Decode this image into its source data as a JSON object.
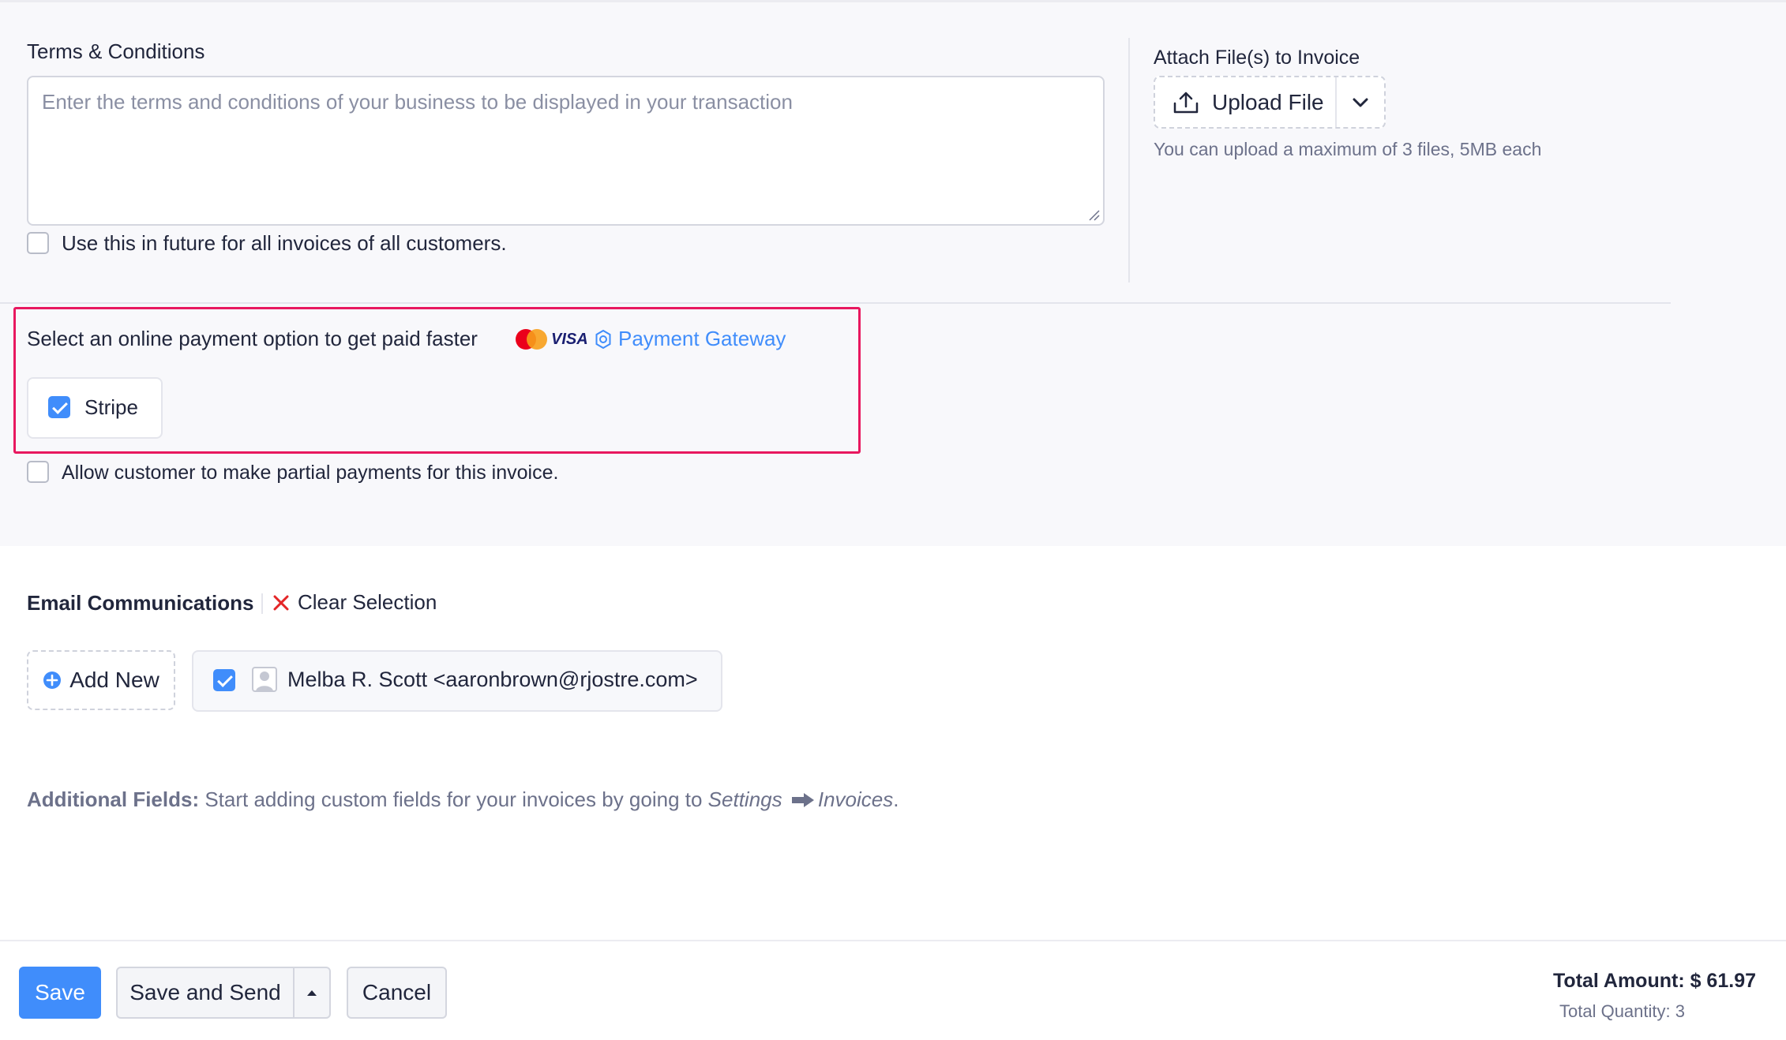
{
  "terms": {
    "label": "Terms & Conditions",
    "placeholder": "Enter the terms and conditions of your business to be displayed in your transaction",
    "future_use_label": "Use this in future for all invoices of all customers."
  },
  "attachments": {
    "label": "Attach File(s) to Invoice",
    "upload_label": "Upload File",
    "hint": "You can upload a maximum of 3 files, 5MB each"
  },
  "payment": {
    "prompt": "Select an online payment option to get paid faster",
    "visa_text": "VISA",
    "gateway_link": "Payment Gateway",
    "stripe_label": "Stripe",
    "partial_label": "Allow customer to make partial payments for this invoice."
  },
  "email": {
    "heading": "Email Communications",
    "clear_label": "Clear Selection",
    "add_new_label": "Add New",
    "contact": "Melba R. Scott <aaronbrown@rjostre.com>"
  },
  "additional": {
    "bold": "Additional Fields:",
    "text": " Start adding custom fields for your invoices by going to ",
    "settings": "Settings",
    "invoices": "Invoices",
    "end": "."
  },
  "footer": {
    "save_label": "Save",
    "save_send_label": "Save and Send",
    "cancel_label": "Cancel",
    "total_amount": "Total Amount: $ 61.97",
    "total_quantity": "Total Quantity: 3"
  },
  "colors": {
    "accent": "#408dfb",
    "highlight_border": "#e8185f",
    "clear_x": "#e42527"
  }
}
